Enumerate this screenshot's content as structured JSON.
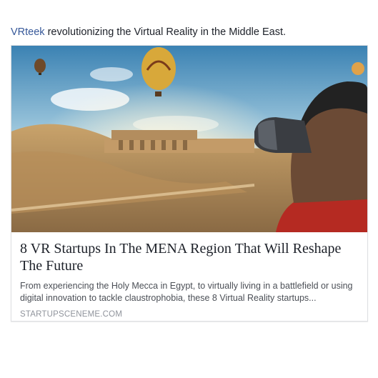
{
  "post": {
    "page_name": "VRteek",
    "text": " revolutionizing the Virtual Reality in the Middle East."
  },
  "link_card": {
    "title": "8 VR Startups In The MENA Region That Will Reshape The Future",
    "description": "From experiencing the Holy Mecca in Egypt, to virtually living in a battlefield or using digital innovation to tackle claustrophobia, these 8 Virtual Reality startups...",
    "domain": "STARTUPSCENEME.COM"
  }
}
